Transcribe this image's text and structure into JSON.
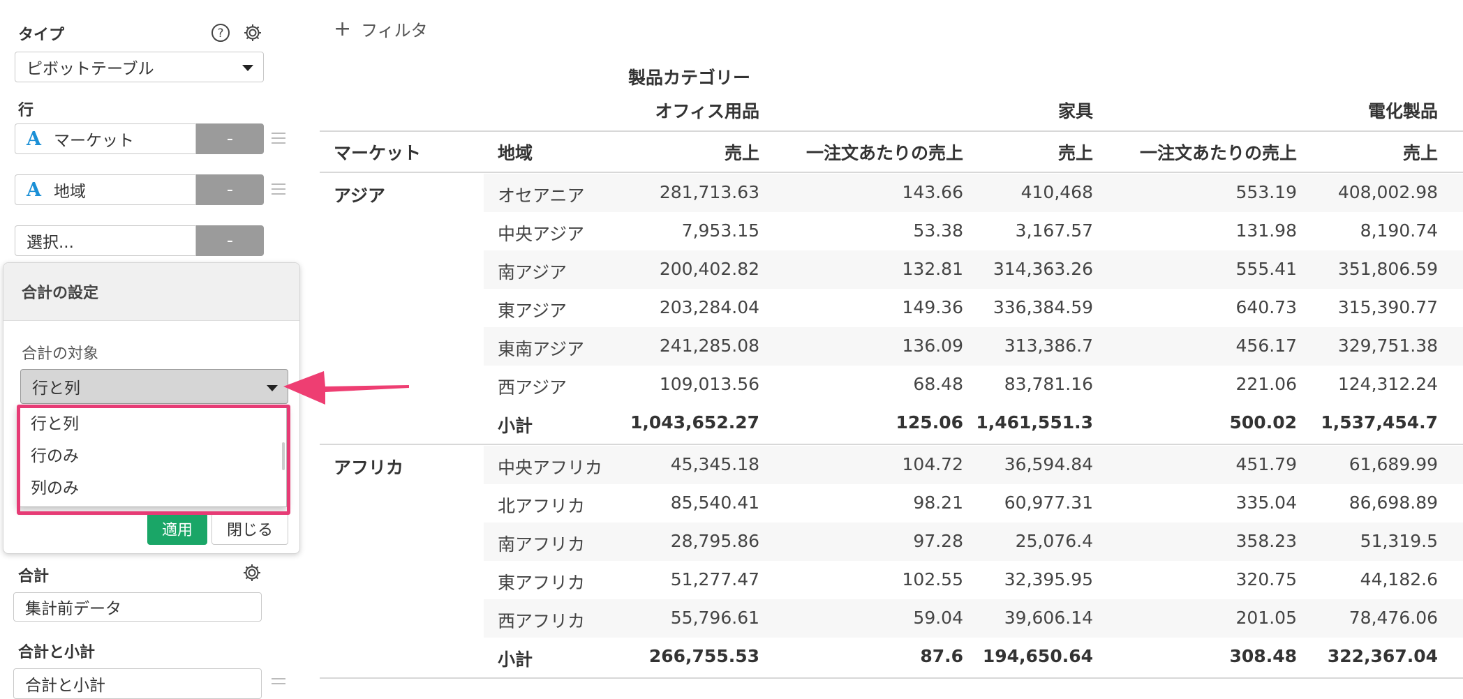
{
  "sidebar": {
    "type_label": "タイプ",
    "type_value": "ピボットテーブル",
    "row_label": "行",
    "row_fields": [
      {
        "icon": "A",
        "name": "マーケット",
        "minus": "-"
      },
      {
        "icon": "A",
        "name": "地域",
        "minus": "-"
      }
    ],
    "select_placeholder": "選択...",
    "select_minus": "-",
    "total_label": "合計",
    "total_value": "集計前データ",
    "subtotal_label": "合計と小計",
    "subtotal_value": "合計と小計"
  },
  "popover": {
    "title": "合計の設定",
    "target_label": "合計の対象",
    "target_value": "行と列",
    "options": [
      "行と列",
      "行のみ",
      "列のみ"
    ],
    "apply": "適用",
    "close": "閉じる"
  },
  "filter": {
    "label": "フィルタ",
    "plus": "+"
  },
  "colors": {
    "accent_green": "#1aa667",
    "highlight_pink": "#e63b75",
    "field_icon_blue": "#1a8fd6"
  },
  "table": {
    "group_header": "製品カテゴリー",
    "categories": [
      "オフィス用品",
      "家具",
      "電化製品"
    ],
    "columns": [
      "マーケット",
      "地域",
      "売上",
      "一注文あたりの売上",
      "売上",
      "一注文あたりの売上",
      "売上"
    ],
    "groups": [
      {
        "market": "アジア",
        "rows": [
          [
            "オセアニア",
            "281,713.63",
            "143.66",
            "410,468",
            "553.19",
            "408,002.98"
          ],
          [
            "中央アジア",
            "7,953.15",
            "53.38",
            "3,167.57",
            "131.98",
            "8,190.74"
          ],
          [
            "南アジア",
            "200,402.82",
            "132.81",
            "314,363.26",
            "555.41",
            "351,806.59"
          ],
          [
            "東アジア",
            "203,284.04",
            "149.36",
            "336,384.59",
            "640.73",
            "315,390.77"
          ],
          [
            "東南アジア",
            "241,285.08",
            "136.09",
            "313,386.7",
            "456.17",
            "329,751.38"
          ],
          [
            "西アジア",
            "109,013.56",
            "68.48",
            "83,781.16",
            "221.06",
            "124,312.24"
          ]
        ],
        "subtotal": [
          "小計",
          "1,043,652.27",
          "125.06",
          "1,461,551.3",
          "500.02",
          "1,537,454.7"
        ]
      },
      {
        "market": "アフリカ",
        "rows": [
          [
            "中央アフリカ",
            "45,345.18",
            "104.72",
            "36,594.84",
            "451.79",
            "61,689.99"
          ],
          [
            "北アフリカ",
            "85,540.41",
            "98.21",
            "60,977.31",
            "335.04",
            "86,698.89"
          ],
          [
            "南アフリカ",
            "28,795.86",
            "97.28",
            "25,076.4",
            "358.23",
            "51,319.5"
          ],
          [
            "東アフリカ",
            "51,277.47",
            "102.55",
            "32,395.95",
            "320.75",
            "44,182.6"
          ],
          [
            "西アフリカ",
            "55,796.61",
            "59.04",
            "39,606.14",
            "201.05",
            "78,476.06"
          ]
        ],
        "subtotal": [
          "小計",
          "266,755.53",
          "87.6",
          "194,650.64",
          "308.48",
          "322,367.04"
        ]
      }
    ]
  }
}
